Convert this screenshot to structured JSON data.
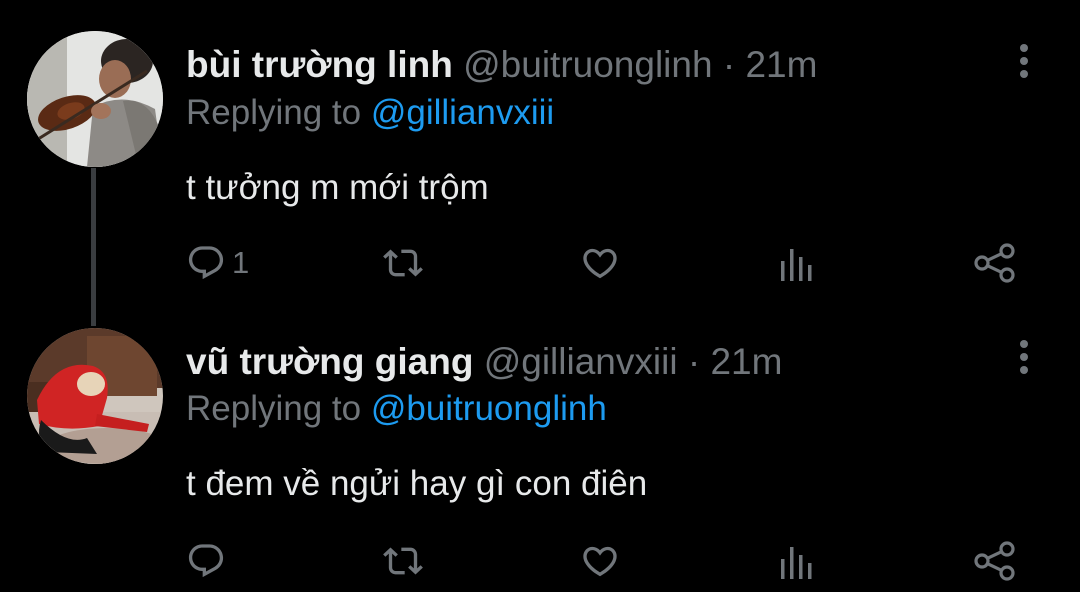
{
  "colors": {
    "background": "#000000",
    "primary_text": "#e7e9ea",
    "secondary_text": "#71767b",
    "link": "#1d9bf0",
    "thread_line": "#3a3d40"
  },
  "tweets": [
    {
      "display_name": "bùi trường linh",
      "handle": "@buitruonglinh",
      "separator": "·",
      "time": "21m",
      "replying_prefix": "Replying to",
      "replying_to": "@gillianvxiii",
      "text": "t tưởng m mới trộm",
      "reply_count": "1",
      "avatar_icon": "avatar-photo",
      "icons": [
        "reply-icon",
        "retweet-icon",
        "like-icon",
        "views-icon",
        "share-icon",
        "more-options-icon"
      ]
    },
    {
      "display_name": "vũ trường giang",
      "handle": "@gillianvxiii",
      "separator": "·",
      "time": "21m",
      "replying_prefix": "Replying to",
      "replying_to": "@buitruonglinh",
      "text": "t đem về ngửi hay gì con điên",
      "reply_count": "",
      "avatar_icon": "avatar-photo",
      "icons": [
        "reply-icon",
        "retweet-icon",
        "like-icon",
        "views-icon",
        "share-icon",
        "more-options-icon"
      ]
    }
  ]
}
